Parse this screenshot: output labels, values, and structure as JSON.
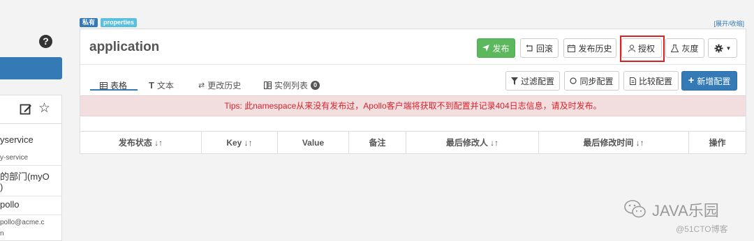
{
  "sidebar": {
    "help_icon": "?",
    "icons": [
      "edit-icon",
      "star-icon"
    ],
    "rows": [
      {
        "text": "yservice",
        "small": false
      },
      {
        "text": "y-service",
        "small": true
      },
      {
        "text": "的部门(myO",
        "small": false
      },
      {
        "text": ")",
        "small": false
      },
      {
        "text": "pollo",
        "small": false
      },
      {
        "text": "pollo@acme.c",
        "small": true
      },
      {
        "text": "n",
        "small": true
      }
    ]
  },
  "namespace": {
    "private_badge": "私有",
    "format_badge": "properties",
    "expand_toggle": "[展开/收缩]",
    "title": "application"
  },
  "header_buttons": {
    "publish": "发布",
    "rollback": "回滚",
    "publish_history": "发布历史",
    "authorize": "授权",
    "gray": "灰度",
    "settings_icon": "gear-icon"
  },
  "tabs": {
    "table": "表格",
    "text": "文本",
    "change_history": "更改历史",
    "instances": "实例列表",
    "instances_count": "0"
  },
  "toolbar": {
    "filter": "过滤配置",
    "sync": "同步配置",
    "compare": "比较配置",
    "add": "新增配置"
  },
  "tips": "Tips: 此namespace从来没有发布过，Apollo客户端将获取不到配置并记录404日志信息，请及时发布。",
  "table": {
    "columns": [
      "发布状态 ↓↑",
      "Key ↓↑",
      "Value",
      "备注",
      "最后修改人 ↓↑",
      "最后修改时间 ↓↑",
      "操作"
    ]
  },
  "watermark": {
    "brand": "JAVA乐园",
    "blog": "@51CTO博客"
  },
  "colors": {
    "publish_green": "#5cb85c",
    "primary_blue": "#337ab7",
    "tips_red": "#d9232d",
    "highlight_red": "#e02020"
  }
}
